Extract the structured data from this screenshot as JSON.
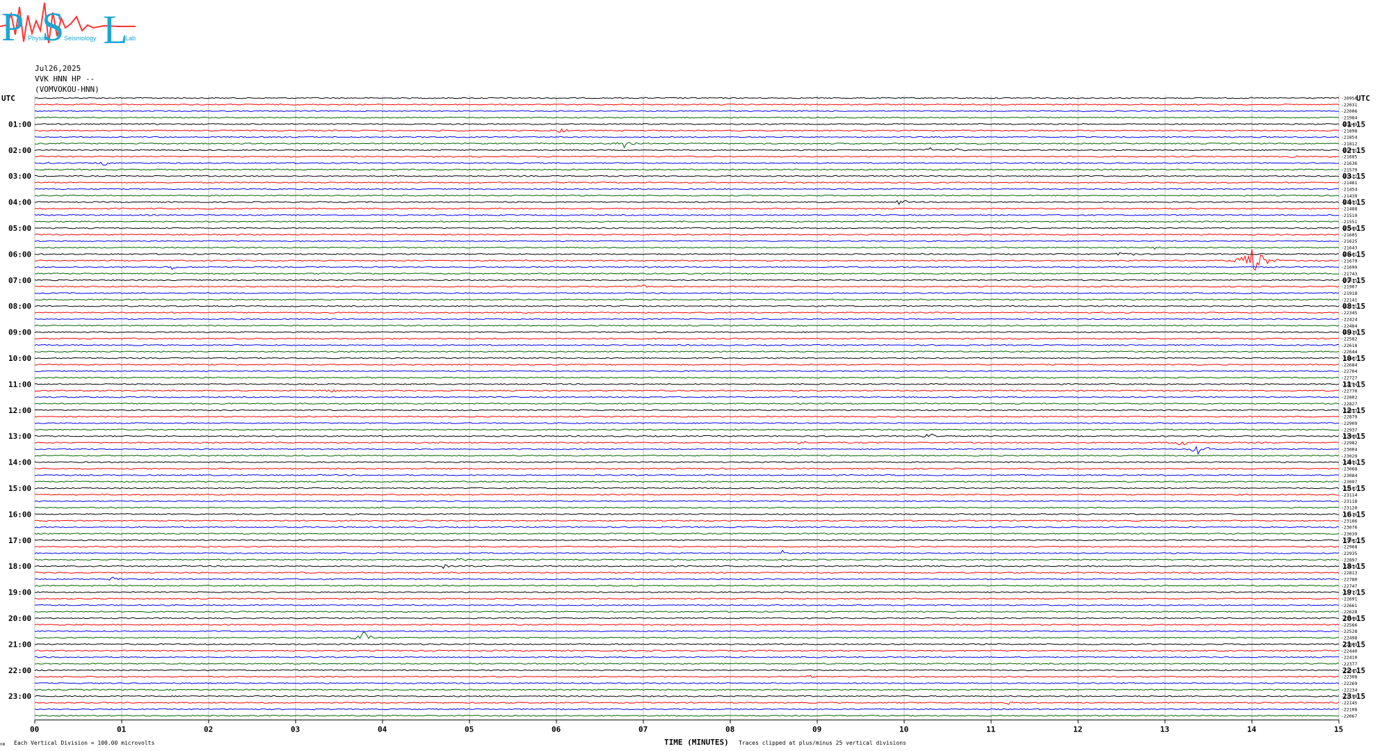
{
  "logo": {
    "letter_1": "P",
    "letter_2": "S",
    "letter_3": "L",
    "small_1": "Physics",
    "small_2": "Seismology",
    "small_3": "Lab"
  },
  "header": {
    "date": "Jul26,2025",
    "channel": "VVK HNN HP --",
    "station": "(VOMVOKOU-HNN)"
  },
  "colors": {
    "trace_cycle": [
      "#000000",
      "#ff0000",
      "#0000ff",
      "#006400"
    ],
    "grid": "#c0c0c0",
    "logo_red": "#ff3333",
    "logo_blue": "#1aa7d6"
  },
  "chart_data": {
    "type": "line",
    "title": "",
    "xlabel": "TIME (MINUTES)",
    "ylabel": "",
    "xlim": [
      0,
      15
    ],
    "x_ticks": [
      "00",
      "01",
      "02",
      "03",
      "04",
      "05",
      "06",
      "07",
      "08",
      "09",
      "10",
      "11",
      "12",
      "13",
      "14",
      "15"
    ],
    "grid": true,
    "left_axis_label": "UTC",
    "right_axis_label": "UTC",
    "left_hour_labels": [
      "01:00",
      "02:00",
      "03:00",
      "04:00",
      "05:00",
      "06:00",
      "07:00",
      "08:00",
      "09:00",
      "10:00",
      "11:00",
      "12:00",
      "13:00",
      "14:00",
      "15:00",
      "16:00",
      "17:00",
      "18:00",
      "19:00",
      "20:00",
      "21:00",
      "22:00",
      "23:00"
    ],
    "right_hour_labels": [
      "01:15",
      "02:15",
      "03:15",
      "04:15",
      "05:15",
      "06:15",
      "07:15",
      "08:15",
      "09:15",
      "10:15",
      "11:15",
      "12:15",
      "13:15",
      "14:15",
      "15:15",
      "16:15",
      "17:15",
      "18:15",
      "19:15",
      "20:15",
      "21:15",
      "22:15",
      "23:15"
    ],
    "trace_count": 96,
    "trace_minutes": 15,
    "trace_means": [
      -20956,
      -22031,
      -22006,
      -21984,
      -21949,
      -21898,
      -21854,
      -21812,
      -21751,
      -21685,
      -21636,
      -21579,
      -21522,
      -21481,
      -21454,
      -21439,
      -21453,
      -21488,
      -21519,
      -21551,
      -21586,
      -21605,
      -21625,
      -21643,
      -21661,
      -21679,
      -21699,
      -21743,
      -21815,
      -21907,
      -21918,
      -22141,
      -22251,
      -22345,
      -22424,
      -22484,
      -22539,
      -22582,
      -22618,
      -22644,
      -22667,
      -22684,
      -22704,
      -22727,
      -22754,
      -22770,
      -22802,
      -22827,
      -22853,
      -22879,
      -22909,
      -22937,
      -22960,
      -22982,
      -23004,
      -23029,
      -23051,
      -23068,
      -23084,
      -23097,
      -23107,
      -23114,
      -23118,
      -23120,
      -23116,
      -23106,
      -23076,
      -23039,
      -23002,
      -22968,
      -22935,
      -22897,
      -22854,
      -22813,
      -22780,
      -22747,
      -22717,
      -22691,
      -22661,
      -22628,
      -22596,
      -22566,
      -22528,
      -22498,
      -22469,
      -22440,
      -22410,
      -22377,
      -22345,
      -22308,
      -22269,
      -22234,
      -22190,
      -22145,
      -22108,
      -22067
    ],
    "events": [
      {
        "trace": 5,
        "minute": 6.05,
        "amplitude": 0.5
      },
      {
        "trace": 7,
        "minute": 6.78,
        "amplitude": 1.2
      },
      {
        "trace": 8,
        "minute": 10.3,
        "amplitude": 0.4
      },
      {
        "trace": 8,
        "minute": 10.6,
        "amplitude": 0.3
      },
      {
        "trace": 9,
        "minute": 14.5,
        "amplitude": 0.4
      },
      {
        "trace": 10,
        "minute": 0.2,
        "amplitude": 0.4
      },
      {
        "trace": 10,
        "minute": 0.8,
        "amplitude": 0.4
      },
      {
        "trace": 16,
        "minute": 9.95,
        "amplitude": 0.6
      },
      {
        "trace": 24,
        "minute": 12.55,
        "amplitude": 0.7
      },
      {
        "trace": 23,
        "minute": 12.9,
        "amplitude": 0.4
      },
      {
        "trace": 25,
        "minute": 14.02,
        "amplitude": 2.5
      },
      {
        "trace": 26,
        "minute": 1.58,
        "amplitude": 0.5
      },
      {
        "trace": 29,
        "minute": 6.6,
        "amplitude": 0.4
      },
      {
        "trace": 29,
        "minute": 7.0,
        "amplitude": 0.4
      },
      {
        "trace": 45,
        "minute": 3.4,
        "amplitude": 0.5
      },
      {
        "trace": 52,
        "minute": 10.3,
        "amplitude": 0.5
      },
      {
        "trace": 53,
        "minute": 8.8,
        "amplitude": 0.4
      },
      {
        "trace": 53,
        "minute": 13.2,
        "amplitude": 0.7
      },
      {
        "trace": 54,
        "minute": 13.4,
        "amplitude": 1.1
      },
      {
        "trace": 70,
        "minute": 8.6,
        "amplitude": 0.4
      },
      {
        "trace": 71,
        "minute": 4.9,
        "amplitude": 0.4
      },
      {
        "trace": 72,
        "minute": 4.7,
        "amplitude": 0.4
      },
      {
        "trace": 74,
        "minute": 0.9,
        "amplitude": 0.3
      },
      {
        "trace": 83,
        "minute": 3.78,
        "amplitude": 1.1
      },
      {
        "trace": 89,
        "minute": 8.9,
        "amplitude": 0.3
      },
      {
        "trace": 93,
        "minute": 11.2,
        "amplitude": 0.3
      }
    ]
  },
  "footer": {
    "left_note": "Each Vertical Division =  100.00 microvolts",
    "right_note": "Traces clipped at plus/minus 25 vertical divisions",
    "corner_mark": "nm"
  }
}
